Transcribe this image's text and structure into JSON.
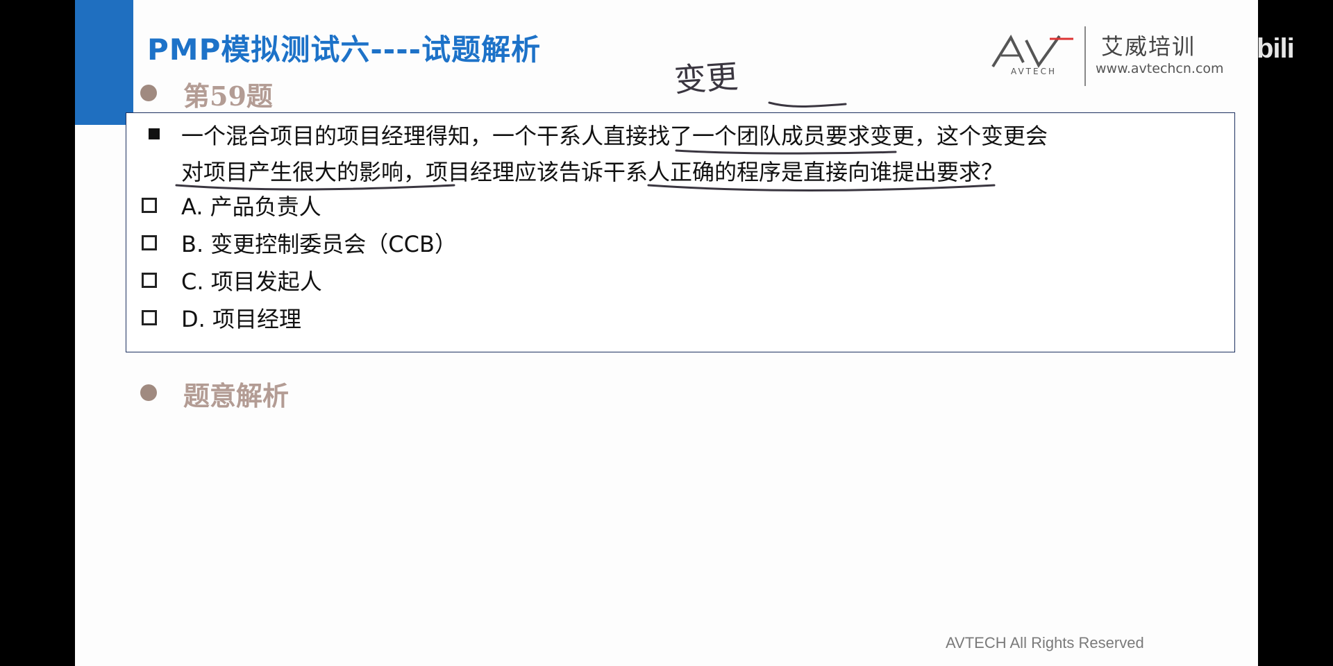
{
  "slide": {
    "title": "PMP模拟测试六----试题解析",
    "question_number": "第59题",
    "analysis_label": "题意解析",
    "handwritten_note": "变更",
    "footer": "AVTECH All Rights Reserved"
  },
  "logo": {
    "brand_text": "AVTECH",
    "chinese_name": "艾威培训",
    "url": "www.avtechcn.com"
  },
  "question": {
    "line1": "一个混合项目的项目经理得知，一个干系人直接找了一个团队成员要求变更，这个变更会",
    "line2": "对项目产生很大的影响，项目经理应该告诉干系人正确的程序是直接向谁提出要求？"
  },
  "options": [
    {
      "label": "A. 产品负责人"
    },
    {
      "label": "B. 变更控制委员会（CCB）"
    },
    {
      "label": "C. 项目发起人"
    },
    {
      "label": "D. 项目经理"
    }
  ],
  "watermark": "bili",
  "colors": {
    "accent": "#1f6fc0",
    "title": "#1d72c8",
    "section": "#b39c94",
    "underline_ink": "#3a3640"
  }
}
